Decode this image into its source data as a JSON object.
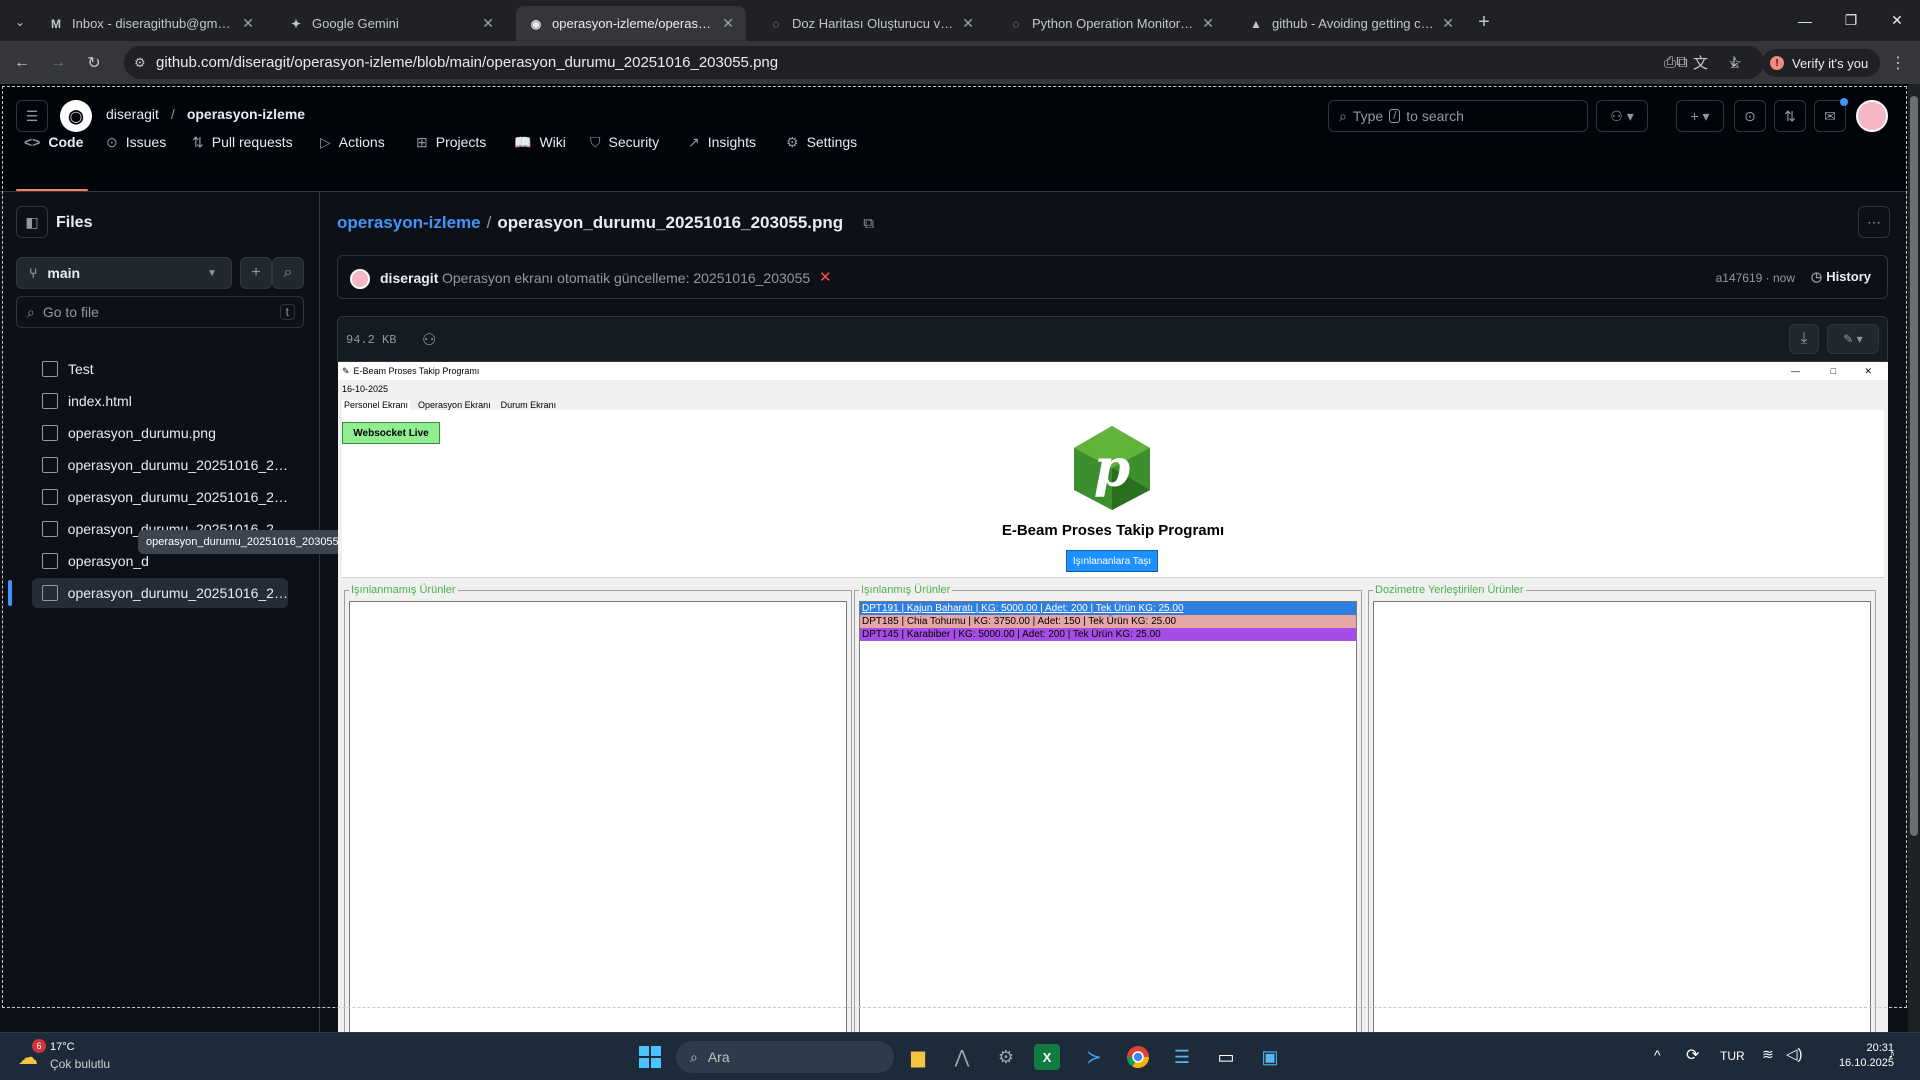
{
  "browser": {
    "tabs": [
      {
        "title": "Inbox - diseragithub@gmail.com",
        "icon": "M",
        "active": false
      },
      {
        "title": "Google Gemini",
        "icon": "✦",
        "active": false
      },
      {
        "title": "operasyon-izleme/operasyon_d",
        "icon": "◉",
        "active": true
      },
      {
        "title": "Doz Haritası Oluşturucu ve Ürü",
        "icon": "◌",
        "active": false
      },
      {
        "title": "Python Operation Monitoring S",
        "icon": "◌",
        "active": false
      },
      {
        "title": "github - Avoiding getting cache",
        "icon": "▲",
        "active": false
      }
    ],
    "url": "github.com/diseragit/operasyon-izleme/blob/main/operasyon_durumu_20251016_203055.png",
    "verify_label": "Verify it's you"
  },
  "github": {
    "owner": "diseragit",
    "separator": "/",
    "repo": "operasyon-izleme",
    "search_prefix": "Type",
    "search_key": "/",
    "search_suffix": "to search",
    "nav": [
      "Code",
      "Issues",
      "Pull requests",
      "Actions",
      "Projects",
      "Wiki",
      "Security",
      "Insights",
      "Settings"
    ]
  },
  "sidebar": {
    "title": "Files",
    "branch": "main",
    "goto_placeholder": "Go to file",
    "goto_shortcut": "t",
    "files": [
      "Test",
      "index.html",
      "operasyon_durumu.png",
      "operasyon_durumu_20251016_20...",
      "operasyon_durumu_20251016_20...",
      "operasyon_durumu_20251016_20...",
      "operasyon_d",
      "operasyon_durumu_20251016_20..."
    ],
    "tooltip": "operasyon_durumu_20251016_203055.png"
  },
  "main": {
    "breadcrumb_repo": "operasyon-izleme",
    "breadcrumb_sep": "/",
    "file_name": "operasyon_durumu_20251016_203055.png",
    "commit_author": "diseragit",
    "commit_message": "Operasyon ekranı otomatik güncelleme: 20251016_203055",
    "commit_hash": "a147619 · now",
    "history_label": "History",
    "file_size": "94.2 KB"
  },
  "app": {
    "title": "E-Beam Proses Takip Programı",
    "date": "16-10-2025",
    "tabs": [
      "Personel Ekranı",
      "Operasyon Ekranı",
      "Durum Ekranı"
    ],
    "ws_label": "Websocket Live",
    "heading": "E-Beam Proses Takip Programı",
    "move_button": "Işınlananlara Taşı",
    "panels": [
      {
        "label": "Işınlanmamış Ürünler",
        "items": []
      },
      {
        "label": "Işınlanmış Ürünler",
        "items": [
          {
            "text": "DPT191 | Kajun Baharatı | KG: 5000.00 | Adet: 200 | Tek Ürün KG: 25.00",
            "color": "#2f7fe0"
          },
          {
            "text": "DPT185 | Chia Tohumu | KG: 3750.00 | Adet: 150 | Tek Ürün KG: 25.00",
            "color": "#e6a6a6"
          },
          {
            "text": "DPT145 | Karabiber | KG: 5000.00 | Adet: 200 | Tek Ürün KG: 25.00",
            "color": "#a64de6"
          }
        ]
      },
      {
        "label": "Dozimetre Yerleştirilen Ürünler",
        "items": []
      }
    ]
  },
  "taskbar": {
    "weather_temp": "17°C",
    "weather_desc": "Çok bulutlu",
    "weather_badge": "6",
    "search_placeholder": "Ara",
    "lang": "TUR",
    "time": "20:31",
    "date": "16.10.2025"
  },
  "colors": {
    "link": "#4493f8",
    "accent_orange": "#f78166",
    "ws_green": "#90ee90"
  }
}
